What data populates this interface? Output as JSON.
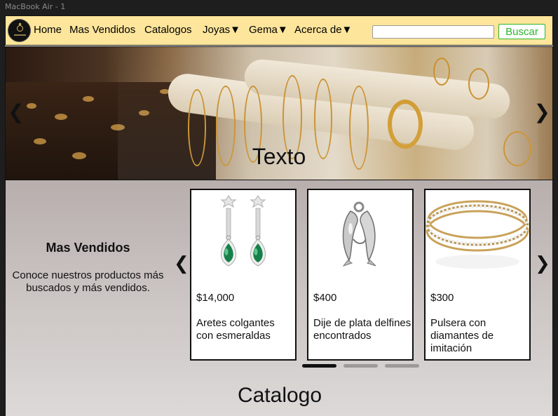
{
  "window": {
    "title": "MacBook Air - 1"
  },
  "nav": {
    "items": [
      "Home",
      "Mas Vendidos",
      "Catalogos",
      "Joyas▼",
      "Gema▼",
      "Acerca de▼"
    ],
    "search_value": "",
    "search_button": "Buscar"
  },
  "hero": {
    "caption": "Texto",
    "prev_icon": "chevron-left",
    "next_icon": "chevron-right"
  },
  "best_sellers": {
    "heading": "Mas Vendidos",
    "description": "Conoce nuestros productos más buscados y más vendidos.",
    "products": [
      {
        "price": "$14,000",
        "name": "Aretes colgantes con esmeraldas",
        "image": "emerald-earrings"
      },
      {
        "price": "$400",
        "name": "Dije de plata delfines encontrados",
        "image": "silver-dolphin-pendant"
      },
      {
        "price": "$300",
        "name": "Pulsera con diamantes de imitación",
        "image": "rhinestone-bracelet"
      }
    ],
    "pager": {
      "count": 3,
      "active_index": 0
    }
  },
  "catalog": {
    "title": "Catalogo"
  },
  "colors": {
    "navbar": "#fde59b",
    "search_button": "#2bb52b",
    "pager_active": "#111111",
    "pager_inactive": "#9e9a99"
  }
}
